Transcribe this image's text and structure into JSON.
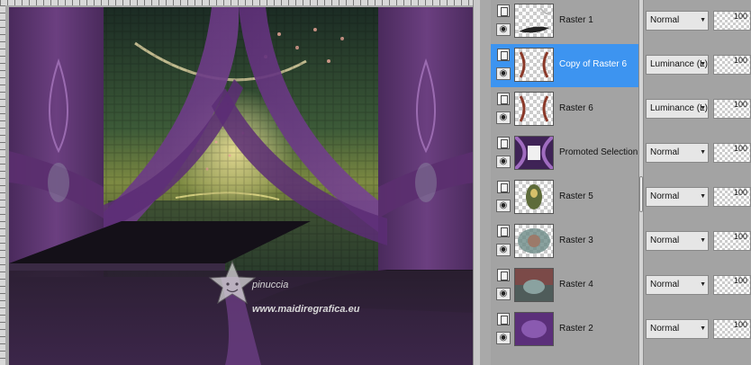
{
  "watermark": {
    "name": "pinuccia",
    "url": "www.maidiregrafica.eu"
  },
  "layers": [
    {
      "name": "Raster 1",
      "blend": "Normal",
      "opacity": "100",
      "selected": false
    },
    {
      "name": "Copy of Raster 6",
      "blend": "Luminance (L)",
      "opacity": "100",
      "selected": true
    },
    {
      "name": "Raster 6",
      "blend": "Luminance (L)",
      "opacity": "100",
      "selected": false
    },
    {
      "name": "Promoted Selection",
      "blend": "Normal",
      "opacity": "100",
      "selected": false
    },
    {
      "name": "Raster 5",
      "blend": "Normal",
      "opacity": "100",
      "selected": false
    },
    {
      "name": "Raster 3",
      "blend": "Normal",
      "opacity": "100",
      "selected": false
    },
    {
      "name": "Raster 4",
      "blend": "Normal",
      "opacity": "100",
      "selected": false
    },
    {
      "name": "Raster 2",
      "blend": "Normal",
      "opacity": "100",
      "selected": false
    }
  ],
  "icons": {
    "visibility": "eye-icon",
    "layer_type": "raster-layer-icon",
    "dropdown": "chevron-down-icon"
  },
  "colors": {
    "selection": "#3d94f0",
    "panel_bg": "#a3a3a3",
    "canvas_purple": "#5a2f6e"
  }
}
